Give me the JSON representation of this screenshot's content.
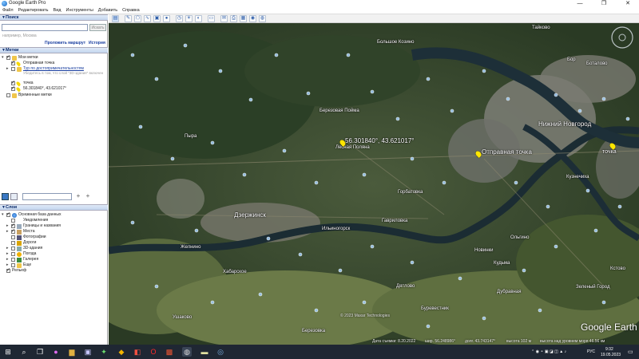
{
  "window": {
    "title": "Google Earth Pro",
    "minimize": "—",
    "maximize": "❐",
    "close": "✕"
  },
  "menu": [
    "Файл",
    "Редактировать",
    "Вид",
    "Инструменты",
    "Добавить",
    "Справка"
  ],
  "search": {
    "header": "Поиск",
    "placeholder": "",
    "button": "Искать",
    "hint": "например, Москва",
    "route_link": "Проложить маршрут",
    "history_link": "История"
  },
  "places": {
    "header": "Метки",
    "items": [
      {
        "label": "Мои метки"
      },
      {
        "label": "Отправная точка"
      },
      {
        "label": "Тур по достопримечательностям"
      },
      {
        "label": "Убедитесь в том, что слой \"3D-здания\" включен"
      },
      {
        "label": "точка"
      },
      {
        "label": "56.301840°, 43.621017°"
      },
      {
        "label": "Временные метки"
      }
    ]
  },
  "layers": {
    "header": "Слои",
    "items": [
      {
        "label": "Основная база данных"
      },
      {
        "label": "Уведомления"
      },
      {
        "label": "Границы и названия"
      },
      {
        "label": "Места"
      },
      {
        "label": "Фотографии"
      },
      {
        "label": "Дороги"
      },
      {
        "label": "3D-здания"
      },
      {
        "label": "Погода"
      },
      {
        "label": "Галерея"
      },
      {
        "label": "Еще"
      },
      {
        "label": "Рельеф"
      }
    ]
  },
  "map": {
    "labels": {
      "bolshoe_kozino": "Большое Козино",
      "berezovaya_poyma": "Березовая Пойма",
      "lesnaya_polyana": "Лесная Поляна",
      "pyra": "Пыра",
      "gorbatovka": "Горбатовка",
      "dzerzhinsk": "Дзержинск",
      "gavrilovka": "Гавриловка",
      "nizhniy_novgorod": "Нижний Новгород",
      "kuznechikha": "Кузнечиха",
      "tochka": "точка",
      "otpravnaya": "Отправная точка",
      "coord": "56.301840°, 43.621017°",
      "zhelnino": "Желнино",
      "khabarskoe": "Хабарское",
      "ilyinogorsk": "Ильиногорск",
      "novinki": "Новинки",
      "olgino": "Ольгино",
      "kudma": "Кудьма",
      "zelenyy_gorod": "Зеленый Город",
      "dyatkovo": "Дятлово",
      "burevestnik": "Буревестник",
      "ushakovo": "Ушаково",
      "berezovka": "Березовка",
      "bor": "Бор",
      "kstovo": "Кстово",
      "dubravnaya": "Дубравная",
      "taikovo": "Тайково",
      "botalovo": "Боталово"
    },
    "logo": "Google Earth",
    "copyright": "© 2023 Maxar Technologies",
    "status": {
      "date": "Дата съемки: 8.20.2022",
      "lat": "шир. 56.248986°",
      "lon": "долг. 43.743147°",
      "elev": "высота 102 м",
      "eye": "высота над уровнем моря 46.56 км"
    }
  },
  "taskbar": {
    "lang": "РУС",
    "time": "9:32",
    "date": "19.05.2023"
  },
  "colors": {
    "accent": "#1565c0",
    "pin": "#ffe600",
    "taskbar": "#1f2733"
  }
}
